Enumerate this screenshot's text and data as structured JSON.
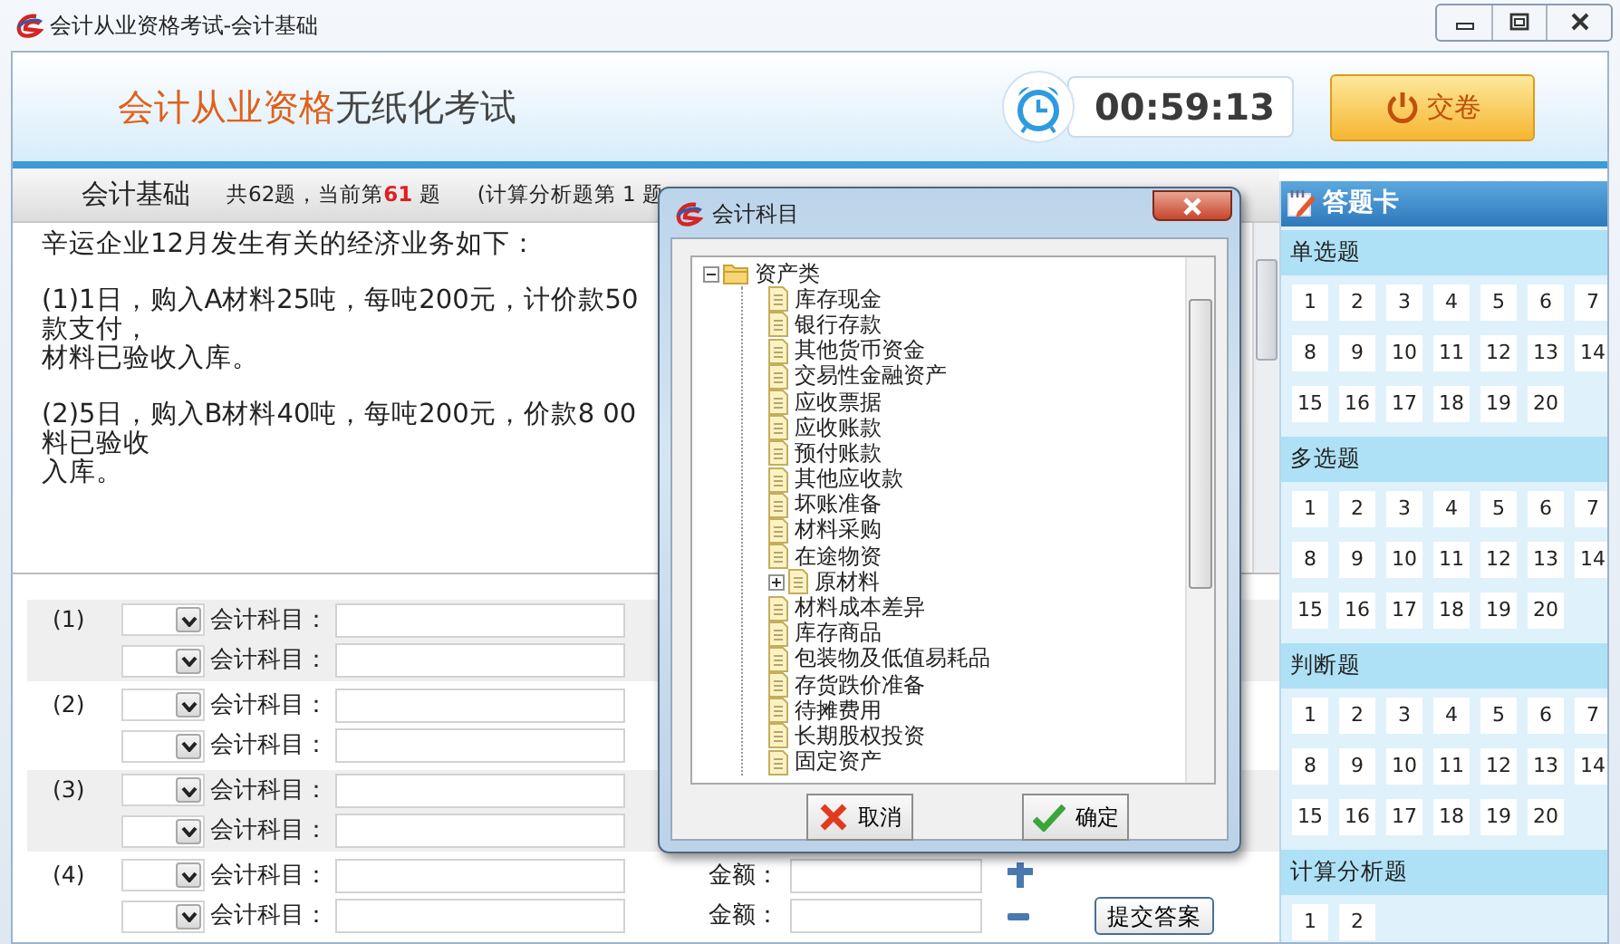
{
  "window": {
    "title": "会计从业资格考试-会计基础"
  },
  "header": {
    "title_highlight": "会计从业资格",
    "title_rest": "无纸化考试",
    "timer": "00:59:13",
    "submit_button": "交卷"
  },
  "info_bar": {
    "subject": "会计基础",
    "progress_prefix": "共62题，当前第",
    "current": "61",
    "progress_suffix": "题",
    "section": "(计算分析题第 1 题"
  },
  "question": {
    "paragraphs": [
      [
        "辛运企业12月发生有关的经济业务如下："
      ],
      [
        "(1)1日，购入A材料25吨，每吨200元，计价款50",
        "款支付，",
        "材料已验收入库。"
      ],
      [
        "(2)5日，购入B材料40吨，每吨200元，价款8 00",
        "料已验收",
        "入库。"
      ]
    ]
  },
  "answer_rows": [
    {
      "group": "(1)",
      "account_label": "会计科目："
    },
    {
      "account_label": "会计科目："
    },
    {
      "group": "(2)",
      "account_label": "会计科目："
    },
    {
      "account_label": "会计科目："
    },
    {
      "group": "(3)",
      "account_label": "会计科目："
    },
    {
      "account_label": "会计科目："
    },
    {
      "group": "(4)",
      "account_label": "会计科目：",
      "amount_label": "金额：",
      "add_button": true
    },
    {
      "account_label": "会计科目：",
      "amount_label": "金额：",
      "remove_button": true,
      "submit_button": "提交答案"
    }
  ],
  "answer_card": {
    "title": "答题卡",
    "sections": [
      {
        "title": "单选题",
        "numbers": [
          "1",
          "2",
          "3",
          "4",
          "5",
          "6",
          "7",
          "8",
          "9",
          "10",
          "11",
          "12",
          "13",
          "14",
          "15",
          "16",
          "17",
          "18",
          "19",
          "20"
        ]
      },
      {
        "title": "多选题",
        "numbers": [
          "1",
          "2",
          "3",
          "4",
          "5",
          "6",
          "7",
          "8",
          "9",
          "10",
          "11",
          "12",
          "13",
          "14",
          "15",
          "16",
          "17",
          "18",
          "19",
          "20"
        ]
      },
      {
        "title": "判断题",
        "numbers": [
          "1",
          "2",
          "3",
          "4",
          "5",
          "6",
          "7",
          "8",
          "9",
          "10",
          "11",
          "12",
          "13",
          "14",
          "15",
          "16",
          "17",
          "18",
          "19",
          "20"
        ]
      },
      {
        "title": "计算分析题",
        "numbers": [
          "1",
          "2"
        ]
      }
    ]
  },
  "dialog": {
    "title": "会计科目",
    "tree": [
      {
        "label": "资产类",
        "expanded": true,
        "children": [
          {
            "label": "库存现金"
          },
          {
            "label": "银行存款"
          },
          {
            "label": "其他货币资金"
          },
          {
            "label": "交易性金融资产"
          },
          {
            "label": "应收票据"
          },
          {
            "label": "应收账款"
          },
          {
            "label": "预付账款"
          },
          {
            "label": "其他应收款"
          },
          {
            "label": "坏账准备"
          },
          {
            "label": "材料采购"
          },
          {
            "label": "在途物资"
          },
          {
            "label": "原材料",
            "expanded": false
          },
          {
            "label": "材料成本差异"
          },
          {
            "label": "库存商品"
          },
          {
            "label": "包装物及低值易耗品"
          },
          {
            "label": "存货跌价准备"
          },
          {
            "label": "待摊费用"
          },
          {
            "label": "长期股权投资"
          },
          {
            "label": "固定资产"
          }
        ]
      }
    ],
    "cancel_button": "取消",
    "ok_button": "确定"
  }
}
